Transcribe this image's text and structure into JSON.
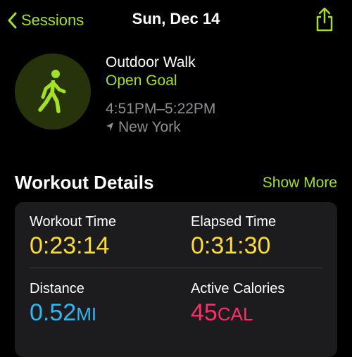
{
  "nav": {
    "back_label": "Sessions",
    "title": "Sun, Dec 14",
    "back_icon": "chevron-left-icon",
    "share_icon": "share-icon"
  },
  "workout": {
    "icon": "walking-figure-icon",
    "name": "Outdoor Walk",
    "goal": "Open Goal",
    "time_range": "4:51PM–5:22PM",
    "location_icon": "location-arrow-icon",
    "location": "New York"
  },
  "details": {
    "title": "Workout Details",
    "show_more": "Show More",
    "metrics": [
      {
        "label": "Workout Time",
        "value": "0:23:14",
        "unit": "",
        "color": "#fedc32"
      },
      {
        "label": "Elapsed Time",
        "value": "0:31:30",
        "unit": "",
        "color": "#fedc32"
      },
      {
        "label": "Distance",
        "value": "0.52",
        "unit": "MI",
        "color": "#2fb6f5"
      },
      {
        "label": "Active Calories",
        "value": "45",
        "unit": "CAL",
        "color": "#fc2f68"
      }
    ]
  },
  "colors": {
    "accent": "#a4e124",
    "background": "#000000",
    "card": "#1c1c1e"
  }
}
